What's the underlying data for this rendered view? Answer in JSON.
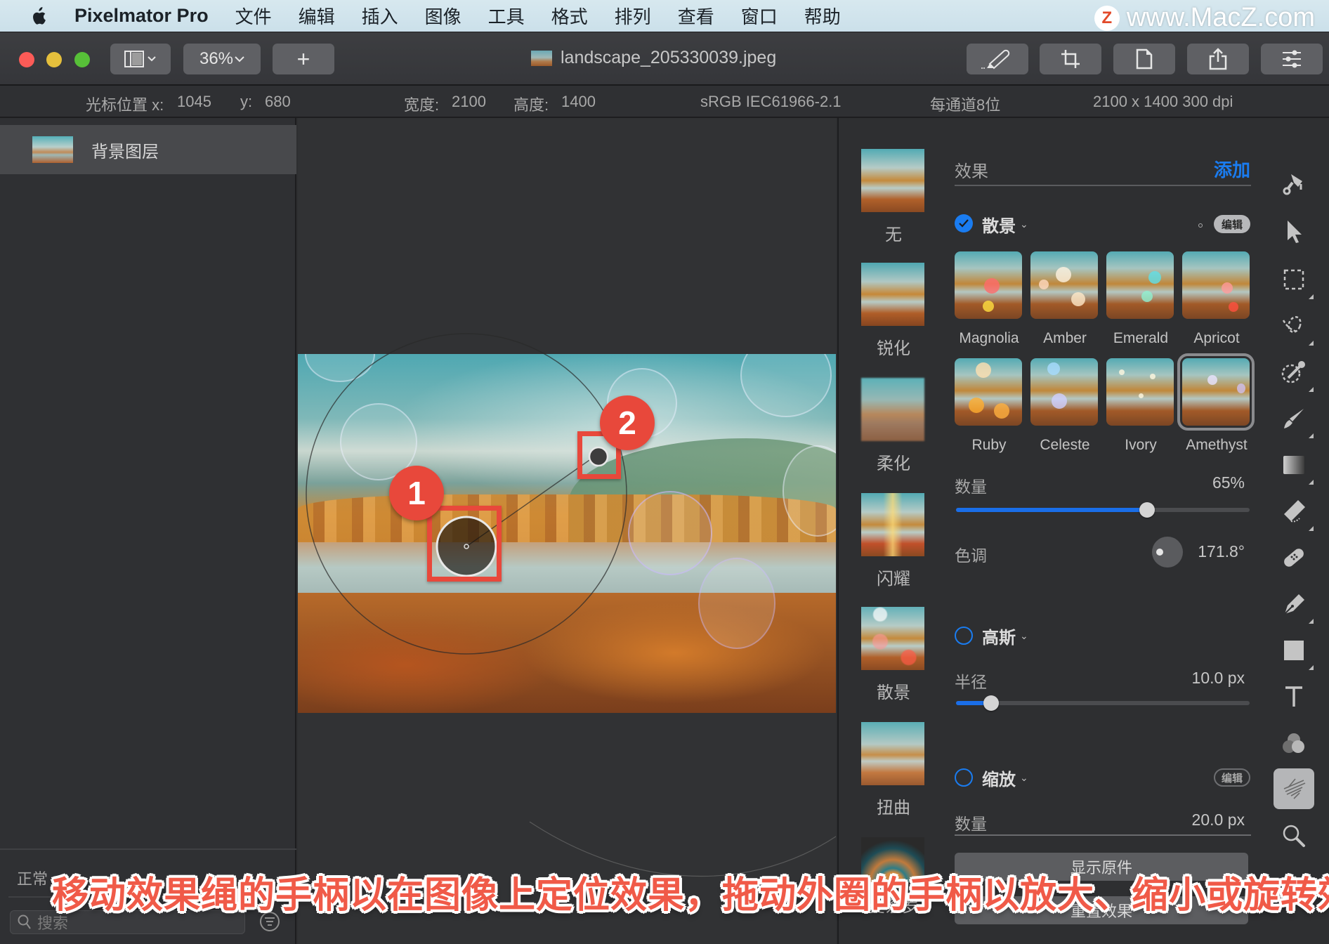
{
  "menubar": {
    "app_name": "Pixelmator Pro",
    "menus": [
      "文件",
      "编辑",
      "插入",
      "图像",
      "工具",
      "格式",
      "排列",
      "查看",
      "窗口",
      "帮助"
    ],
    "watermark": "www.MacZ.com",
    "watermark_logo": "Z"
  },
  "toolbar": {
    "zoom_level": "36%",
    "add_label": "+",
    "document_title": "landscape_205330039.jpeg",
    "right_buttons": [
      "draw-icon",
      "crop-icon",
      "page-icon",
      "share-icon",
      "adjust-icon"
    ]
  },
  "infobar": {
    "cursor_label": "光标位置 x:",
    "cursor_x": "1045",
    "cursor_y_label": "y:",
    "cursor_y": "680",
    "width_label": "宽度:",
    "width": "2100",
    "height_label": "高度:",
    "height": "1400",
    "color_profile": "sRGB IEC61966-2.1",
    "bit_depth": "每通道8位",
    "resolution": "2100 x 1400 300 dpi"
  },
  "layers": {
    "items": [
      {
        "name": "背景图层",
        "selected": true
      }
    ],
    "blend_mode": "正常",
    "search_placeholder": "搜索"
  },
  "canvas": {
    "annotations": [
      {
        "number": "1"
      },
      {
        "number": "2"
      }
    ]
  },
  "effect_categories": [
    {
      "label": "无"
    },
    {
      "label": "锐化"
    },
    {
      "label": "柔化"
    },
    {
      "label": "闪耀"
    },
    {
      "label": "散景"
    },
    {
      "label": "扭曲"
    },
    {
      "label": "曼荼罗"
    }
  ],
  "effects_panel": {
    "header_label": "效果",
    "add_label": "添加",
    "accent_color": "#1a7cf0",
    "bokeh": {
      "title": "散景",
      "enabled": true,
      "edit_label": "编辑",
      "presets": [
        {
          "name": "Magnolia",
          "selected": false
        },
        {
          "name": "Amber",
          "selected": false
        },
        {
          "name": "Emerald",
          "selected": false
        },
        {
          "name": "Apricot",
          "selected": false
        },
        {
          "name": "Ruby",
          "selected": false
        },
        {
          "name": "Celeste",
          "selected": false
        },
        {
          "name": "Ivory",
          "selected": false
        },
        {
          "name": "Amethyst",
          "selected": true
        }
      ],
      "amount_label": "数量",
      "amount_value": "65%",
      "amount_fraction": 0.65,
      "hue_label": "色调",
      "hue_value": "171.8°"
    },
    "gaussian": {
      "title": "高斯",
      "enabled": false,
      "radius_label": "半径",
      "radius_value": "10.0 px",
      "radius_fraction": 0.12
    },
    "zoom": {
      "title": "缩放",
      "enabled": false,
      "edit_label": "编辑",
      "amount_label": "数量",
      "amount_value": "20.0 px"
    },
    "show_original_label": "显示原件",
    "reset_label": "重置效果"
  },
  "tools": [
    "style-brush-icon",
    "arrow-select-icon",
    "rect-select-icon",
    "lasso-select-icon",
    "color-select-icon",
    "paint-brush-icon",
    "gradient-icon",
    "erase-icon",
    "repair-icon",
    "pen-icon",
    "shape-icon",
    "type-icon",
    "color-adjust-icon",
    "effects-icon",
    "zoom-icon",
    "more-icon"
  ],
  "active_tool": "effects-icon",
  "caption": "移动效果绳的手柄以在图像上定位效果，拖动外圈的手柄以放大、缩小或旋转效果"
}
